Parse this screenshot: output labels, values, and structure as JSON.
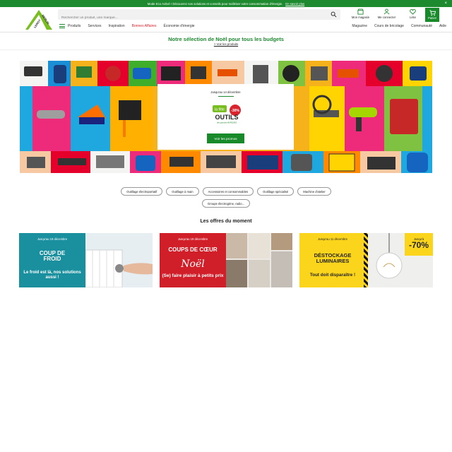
{
  "topbar": {
    "text": "Mode Eco Activé ! Découvrez nos solutions et conseils pour maîtriser votre consommation d'énergie.",
    "link": "En savoir plus",
    "close": "×"
  },
  "brand": {
    "name": "LEROY MERLIN",
    "color": "#78be20"
  },
  "search": {
    "placeholder": "Rechercher un produit, une marque..."
  },
  "header_links": {
    "store": "Mon magasin",
    "account": "Me connecter",
    "list": "Liste",
    "cart": "Panier"
  },
  "nav": {
    "menu": "Produits",
    "items": [
      "Services",
      "Inspiration",
      "Bonnes Affaires",
      "Économie d'énergie"
    ],
    "right": [
      "Magazine",
      "Cours de bricolage",
      "Communauté",
      "Aide"
    ]
  },
  "noel": {
    "title": "Notre sélection de Noël pour tous les budgets",
    "link": "> Voir les produits"
  },
  "hero": {
    "until": "Jusqu'au 14 décembre",
    "fete_small": "la fête",
    "fete_big": "OUTILS",
    "fete_sub": "des grandes MARQUES",
    "fete_badge": "-30%",
    "button": "Voir les promos"
  },
  "chips": [
    "Outillage électroportatif",
    "Outillage à main",
    "Accessoires et consommables",
    "Outillage spécialisé",
    "Machine d'atelier",
    "Groupe électrogène, radio..."
  ],
  "offers": {
    "title": "Les offres du moment",
    "cards": [
      {
        "date": "Jusqu'au 19 décembre",
        "head1": "COUP DE",
        "head2": "FROID",
        "sub": "Le froid est là, nos solutions aussi !"
      },
      {
        "date": "Jusqu'au 19 décembre",
        "head1": "COUPS DE CŒUR",
        "noel": "Noël",
        "sub": "(Se) faire plaisir à petits prix"
      },
      {
        "date": "Jusqu'au 11 décembre",
        "head": "DÉSTOCKAGE LUMINAIRES",
        "sub": "Tout doit disparaître !",
        "badge_top": "Jusqu'à",
        "badge": "-70%"
      }
    ]
  },
  "colors": {
    "green": "#188a2a",
    "red": "#d9232d"
  }
}
